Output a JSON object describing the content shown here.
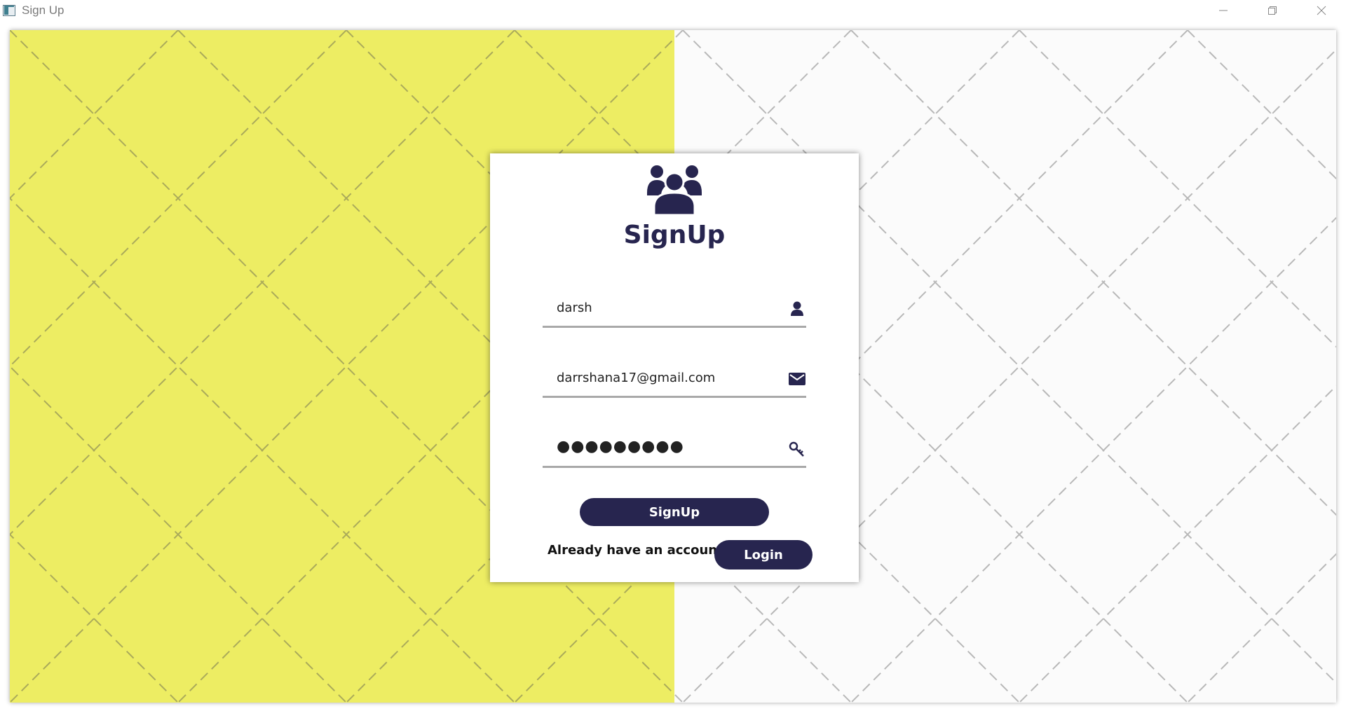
{
  "window": {
    "title": "Sign Up",
    "icon": "app-window-icon",
    "controls": [
      "minimize-icon",
      "restore-icon",
      "close-icon"
    ]
  },
  "background": {
    "left_color": "#eded63",
    "right_color": "#fbfbfb"
  },
  "card": {
    "icon": "users-group-icon",
    "title": "SignUp",
    "fields": {
      "username": {
        "value": "darsh",
        "icon": "user-icon"
      },
      "email": {
        "value": "darrshana17@gmail.com",
        "icon": "envelope-icon"
      },
      "password": {
        "value": "●●●●●●●●●",
        "icon": "key-icon"
      }
    },
    "signup_button_label": "SignUp",
    "login_prompt": "Already have an account ?",
    "login_button_label": "Login",
    "accent_color": "#27254f"
  }
}
